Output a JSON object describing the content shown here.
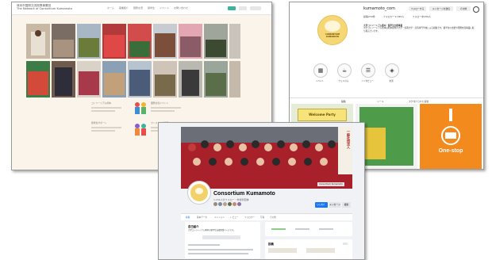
{
  "website": {
    "title_line1": "熊本市国際交流振興事業団",
    "title_line2": "The Network of Consortium Kumamoto",
    "nav": [
      "ホーム",
      "事業紹介",
      "国際交流",
      "留学生",
      "イベント",
      "お問い合わせ"
    ],
    "accent": "#3db39e",
    "cards": [
      {
        "title": "コンソーシアム熊本"
      },
      {
        "title": "国際交流イベント"
      },
      {
        "title": "留学生サポート"
      },
      {
        "title": "ワンストップ窓口"
      }
    ]
  },
  "instagram": {
    "username": "kumamoto_com",
    "buttons": [
      "フォローする",
      "メッセージを送信",
      "その他"
    ],
    "stats": [
      "投稿239件",
      "フォロワー2,345人",
      "フォロー中156人"
    ],
    "bio_title": "大学コンソーシアム熊本・留学生支援事業",
    "bio_text": "大学コンソーシアム熊本は熊本県内の大学・短期大学・高等専門学校による組織です。留学生の支援や国際交流事業に取り組んでいます。",
    "avatar_label": "CONSORTIUM KUMAMOTO",
    "highlights": [
      "イベント",
      "ウェルカム",
      "インタビュー",
      "交流",
      "資料"
    ],
    "tabs": [
      "投稿",
      "リール",
      "タグ付けされた投稿"
    ],
    "post_label": "One-stop",
    "post_badge": "Welcome Party"
  },
  "facebook": {
    "page_name": "Consortium Kumamoto",
    "page_sub": "1,234人がフォロー・非営利団体",
    "tabs": [
      "投稿",
      "基本データ",
      "メンション",
      "レビュー",
      "フォロワー",
      "写真",
      "その他"
    ],
    "buttons": [
      "いいね！",
      "メッセージ",
      "検索"
    ],
    "intro_title": "自己紹介",
    "intro_text": "大学コンソーシアム熊本の留学生支援事業ページです。",
    "side_title": "投稿",
    "cover_banner": "一般社団法人",
    "cover_tag": "Consortium Kumamoto",
    "accent": "#1877f2"
  }
}
